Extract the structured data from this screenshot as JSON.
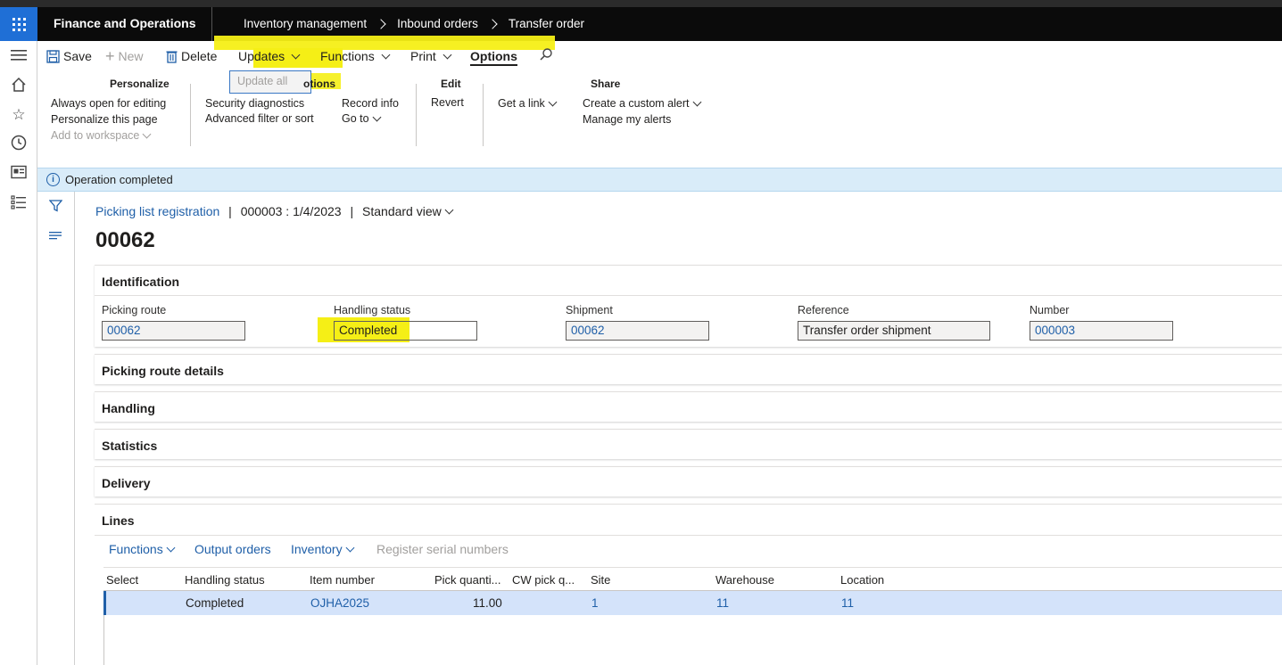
{
  "app": {
    "title": "Finance and Operations",
    "breadcrumb": [
      "Inventory management",
      "Inbound orders",
      "Transfer order"
    ]
  },
  "actions": {
    "save": "Save",
    "new": "New",
    "delete": "Delete",
    "updates": "Updates",
    "functions": "Functions",
    "print": "Print",
    "options": "Options"
  },
  "ribbon": {
    "personalize": {
      "title": "Personalize",
      "items": [
        "Always open for editing",
        "Personalize this page",
        "Add to workspace"
      ]
    },
    "page_options": {
      "title_fragment": "otions",
      "items": [
        "Security diagnostics",
        "Advanced filter or sort",
        "Record info",
        "Go to"
      ]
    },
    "update_all": "Update all",
    "edit": {
      "title": "Edit",
      "items": [
        "Revert"
      ]
    },
    "share": {
      "title": "Share",
      "items": [
        "Get a link",
        "Create a custom alert",
        "Manage my alerts"
      ]
    }
  },
  "message": "Operation completed",
  "page": {
    "crumb_link": "Picking list registration",
    "crumb_record": "000003 : 1/4/2023",
    "view": "Standard view",
    "title": "00062"
  },
  "identification": {
    "title": "Identification",
    "fields": [
      {
        "label": "Picking route",
        "value": "00062"
      },
      {
        "label": "Handling status",
        "value": "Completed"
      },
      {
        "label": "Shipment",
        "value": "00062"
      },
      {
        "label": "Reference",
        "value": "Transfer order shipment"
      },
      {
        "label": "Number",
        "value": "000003"
      }
    ]
  },
  "fasttabs": [
    "Picking route details",
    "Handling",
    "Statistics",
    "Delivery",
    "Lines"
  ],
  "lines": {
    "toolbar": [
      "Functions",
      "Output orders",
      "Inventory",
      "Register serial numbers"
    ],
    "columns": [
      "Select",
      "Handling status",
      "Item number",
      "Pick quanti...",
      "CW pick q...",
      "Site",
      "Warehouse",
      "Location"
    ],
    "rows": [
      {
        "status": "Completed",
        "item": "OJHA2025",
        "pick_qty": "11.00",
        "cw_pick": "",
        "site": "1",
        "warehouse": "11",
        "location": "11"
      }
    ]
  },
  "colors": {
    "accent": "#1f6fd6",
    "link": "#1f5fa8",
    "highlight": "#f5ef16",
    "message_bg": "#d9ecf9"
  },
  "icons": [
    "waffle-icon",
    "menu-icon",
    "home-icon",
    "star-icon",
    "clock-icon",
    "workspace-icon",
    "list-icon",
    "filter-icon",
    "lines-icon",
    "save-icon",
    "plus-icon",
    "trash-icon",
    "search-icon",
    "info-icon"
  ]
}
